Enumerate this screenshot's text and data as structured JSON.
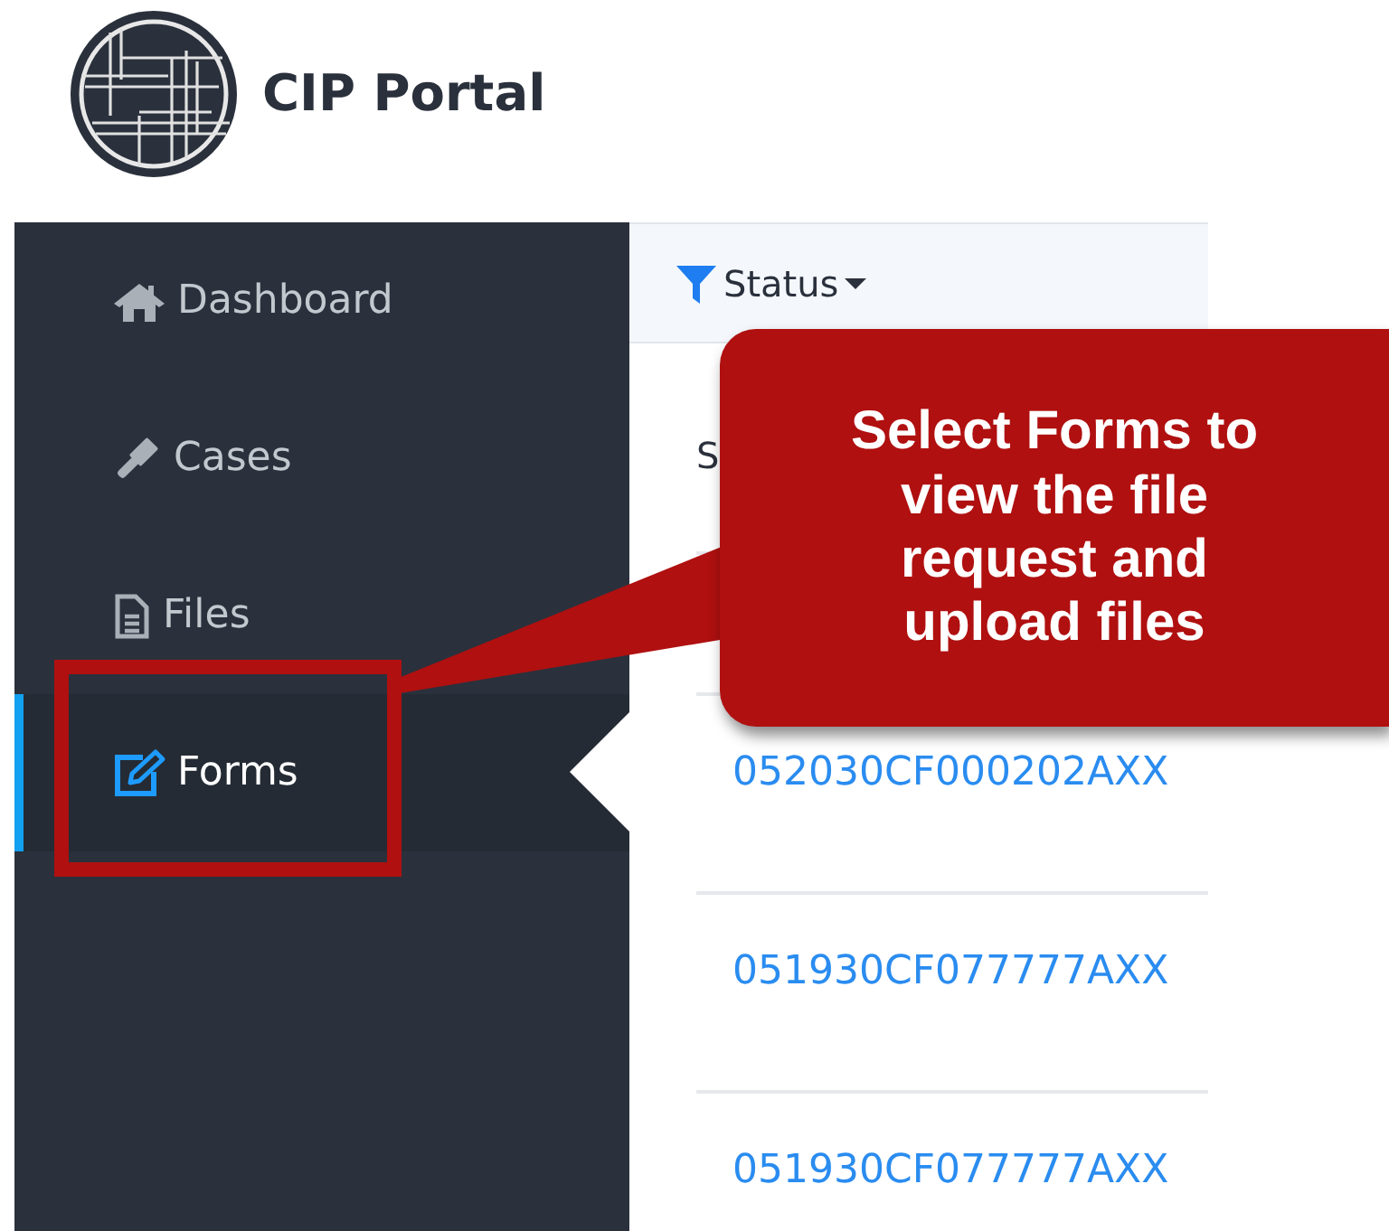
{
  "app": {
    "title": "CIP Portal"
  },
  "sidebar": {
    "items": [
      {
        "label": "Dashboard",
        "kind": "home",
        "selected": false
      },
      {
        "label": "Cases",
        "kind": "gavel",
        "selected": false
      },
      {
        "label": "Files",
        "kind": "file",
        "selected": false
      },
      {
        "label": "Forms",
        "kind": "edit",
        "selected": true
      }
    ]
  },
  "table": {
    "filter": {
      "label": "Status"
    },
    "column_header": "S",
    "rows": [
      {
        "case_number": "052030CF000202AXX"
      },
      {
        "case_number": "051930CF077777AXX"
      },
      {
        "case_number": "051930CF077777AXX"
      }
    ]
  },
  "callout": {
    "text": "Select Forms to\nview the file\nrequest and\nupload files"
  }
}
